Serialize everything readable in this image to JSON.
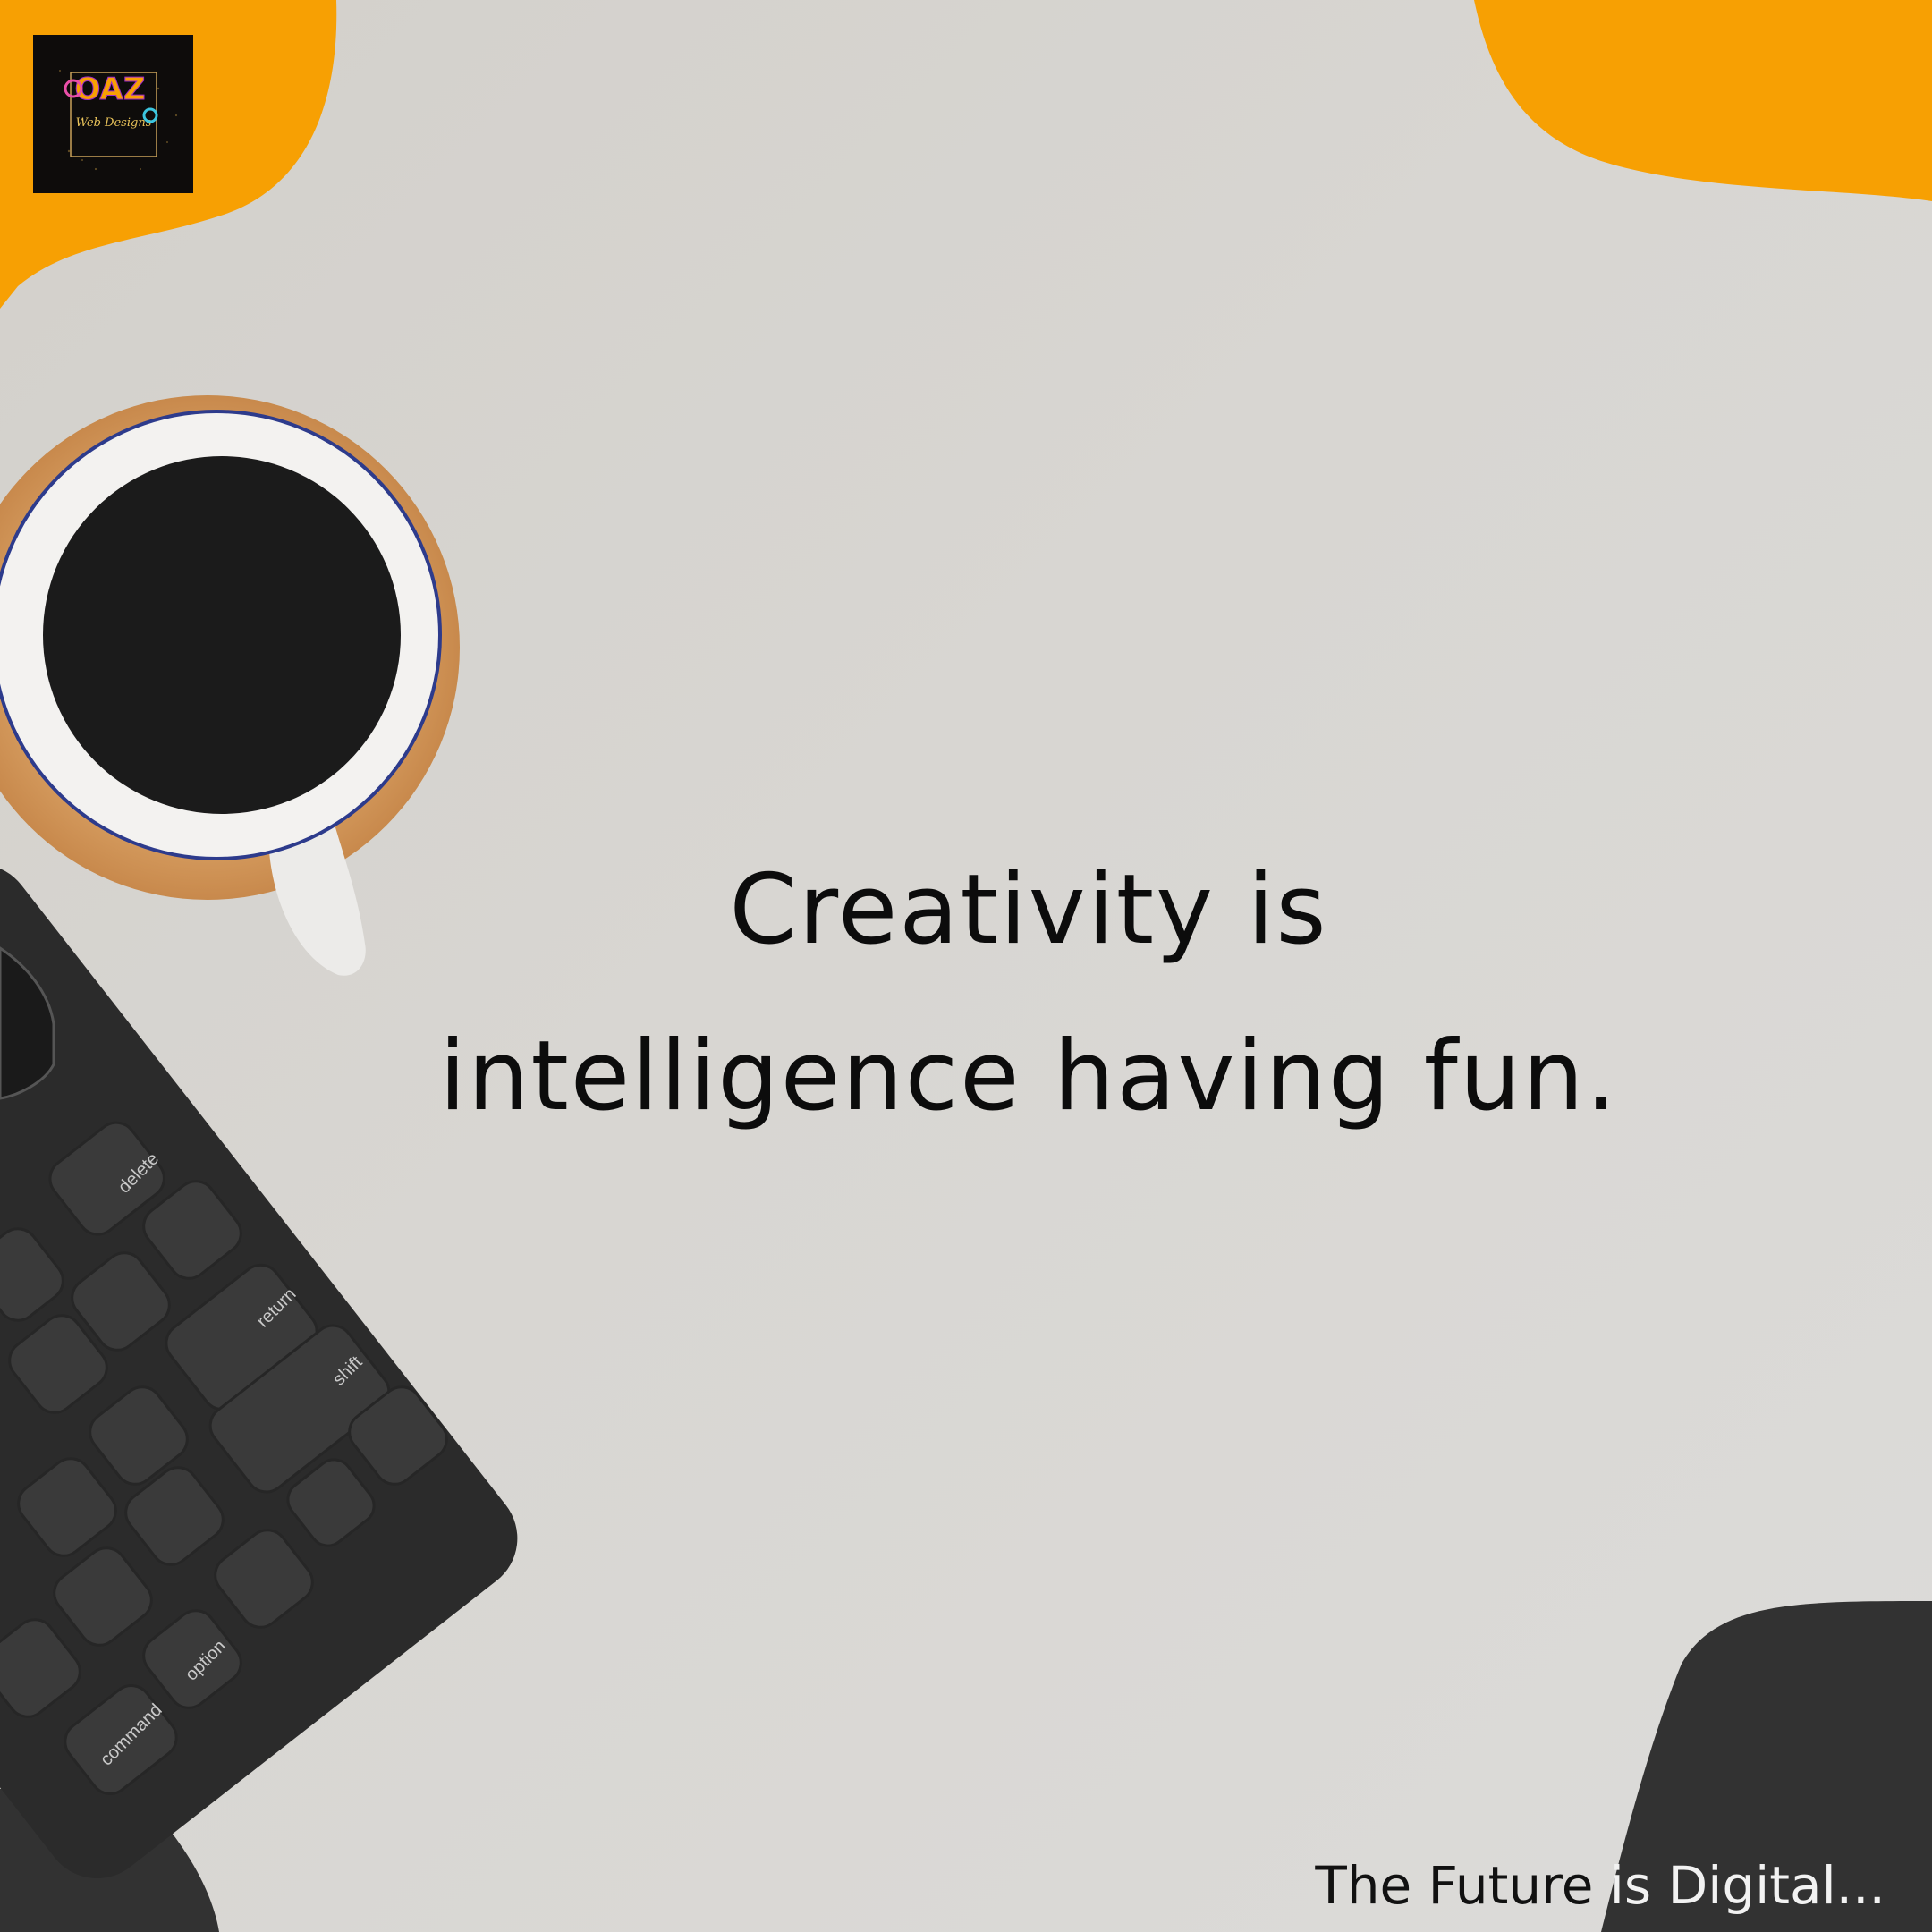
{
  "brand": {
    "logo_text": "OAZ",
    "logo_subtext": "Web Designs"
  },
  "quote": {
    "line1": "Creativity is",
    "line2": "intelligence having fun."
  },
  "tagline": {
    "part1": "The Future",
    "part2": " is Digital..."
  },
  "keyboard": {
    "keys": {
      "delete": "delete",
      "return": "return",
      "shift": "shift",
      "option": "option",
      "command": "command"
    }
  },
  "colors": {
    "accent_orange": "#f7a003",
    "dark_blob": "#323232",
    "background": "#d8d6d2",
    "text": "#0c0c0c"
  },
  "icons": [
    "coffee-cup-icon",
    "keyboard-icon",
    "logo-icon"
  ]
}
